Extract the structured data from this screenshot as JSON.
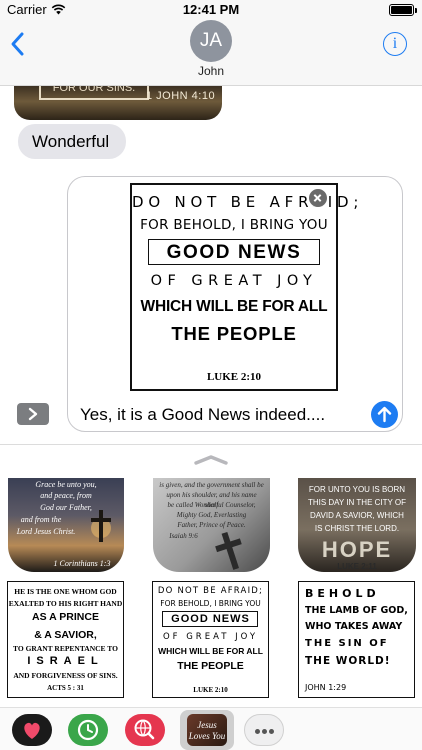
{
  "status_bar": {
    "carrier": "Carrier",
    "time": "12:41 PM"
  },
  "header": {
    "avatar_initials": "JA",
    "contact_name": "John",
    "info_label": "i"
  },
  "messages": {
    "previous_sticker": {
      "visible_text": "FOR OUR SINS.",
      "reference": "1 JOHN 4:10"
    },
    "received": "Wonderful"
  },
  "compose": {
    "message_text": "Yes, it is a Good News indeed....",
    "attachment": {
      "line1": "DO NOT BE AFRAID;",
      "line2": "FOR BEHOLD, I BRING YOU",
      "line3": "GOOD NEWS",
      "line4": "OF GREAT JOY",
      "line5": "WHICH WILL BE FOR ALL",
      "line6": "THE PEOPLE",
      "reference": "LUKE 2:10"
    }
  },
  "drawer": {
    "photo_stickers": [
      {
        "lines": [
          "Grace be unto you,",
          "and peace, from",
          "God our Father,",
          "and from the",
          "Lord Jesus Christ."
        ],
        "reference": "1 Corinthians 1:3"
      },
      {
        "lines": [
          "is given, and the government shall be",
          "upon his shoulder, and his name shall",
          "be called Wonderful Counselor,",
          "Mighty God, Everlasting",
          "Father, Prince of Peace."
        ],
        "reference": "Isaiah 9:6"
      },
      {
        "lines": [
          "FOR UNTO YOU IS BORN",
          "THIS DAY IN THE CITY OF",
          "DAVID A SAVIOR, WHICH",
          "IS CHRIST THE LORD."
        ],
        "word": "HOPE",
        "reference": "LUKE 2:11"
      }
    ],
    "text_stickers": [
      {
        "lines": [
          "HE IS THE ONE WHOM GOD",
          "EXALTED TO HIS RIGHT HAND",
          "AS A PRINCE",
          "& A SAVIOR,",
          "TO GRANT REPENTANCE TO",
          "ISRAEL",
          "AND FORGIVENESS OF SINS."
        ],
        "reference": "ACTS 5 : 31"
      },
      {
        "lines": [
          "DO NOT BE AFRAID;",
          "FOR BEHOLD, I BRING YOU",
          "GOOD NEWS",
          "OF GREAT JOY",
          "WHICH WILL BE FOR ALL",
          "THE PEOPLE"
        ],
        "reference": "LUKE 2:10"
      },
      {
        "lines": [
          "BEHOLD",
          "THE LAMB OF GOD,",
          "WHO TAKES AWAY",
          "THE SIN OF",
          "THE WORLD!"
        ],
        "reference": "JOHN 1:29"
      }
    ]
  },
  "app_strip": {
    "current_app_label": "Jesus Loves You"
  },
  "colors": {
    "accent": "#1d7cf2",
    "bubble_gray": "#e5e5ea",
    "header_bg": "#f7f7f7"
  }
}
